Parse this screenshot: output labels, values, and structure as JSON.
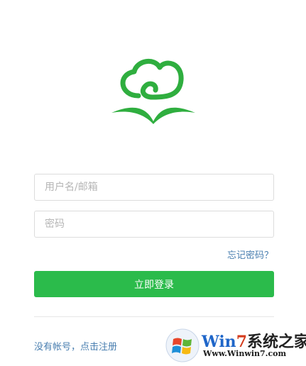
{
  "app": {
    "accent_color": "#2bbb4b",
    "link_color": "#4a7fb0"
  },
  "logo": {
    "icon": "cloud-book-icon"
  },
  "form": {
    "username_placeholder": "用户名/邮箱",
    "password_placeholder": "密码",
    "forgot_label": "忘记密码？",
    "login_label": "立即登录",
    "register_label": "没有帐号，点击注册"
  },
  "watermark": {
    "title_win": "Win",
    "title_seven": "7",
    "title_rest": "系统之家",
    "url": "Www.Winwin7.com"
  }
}
